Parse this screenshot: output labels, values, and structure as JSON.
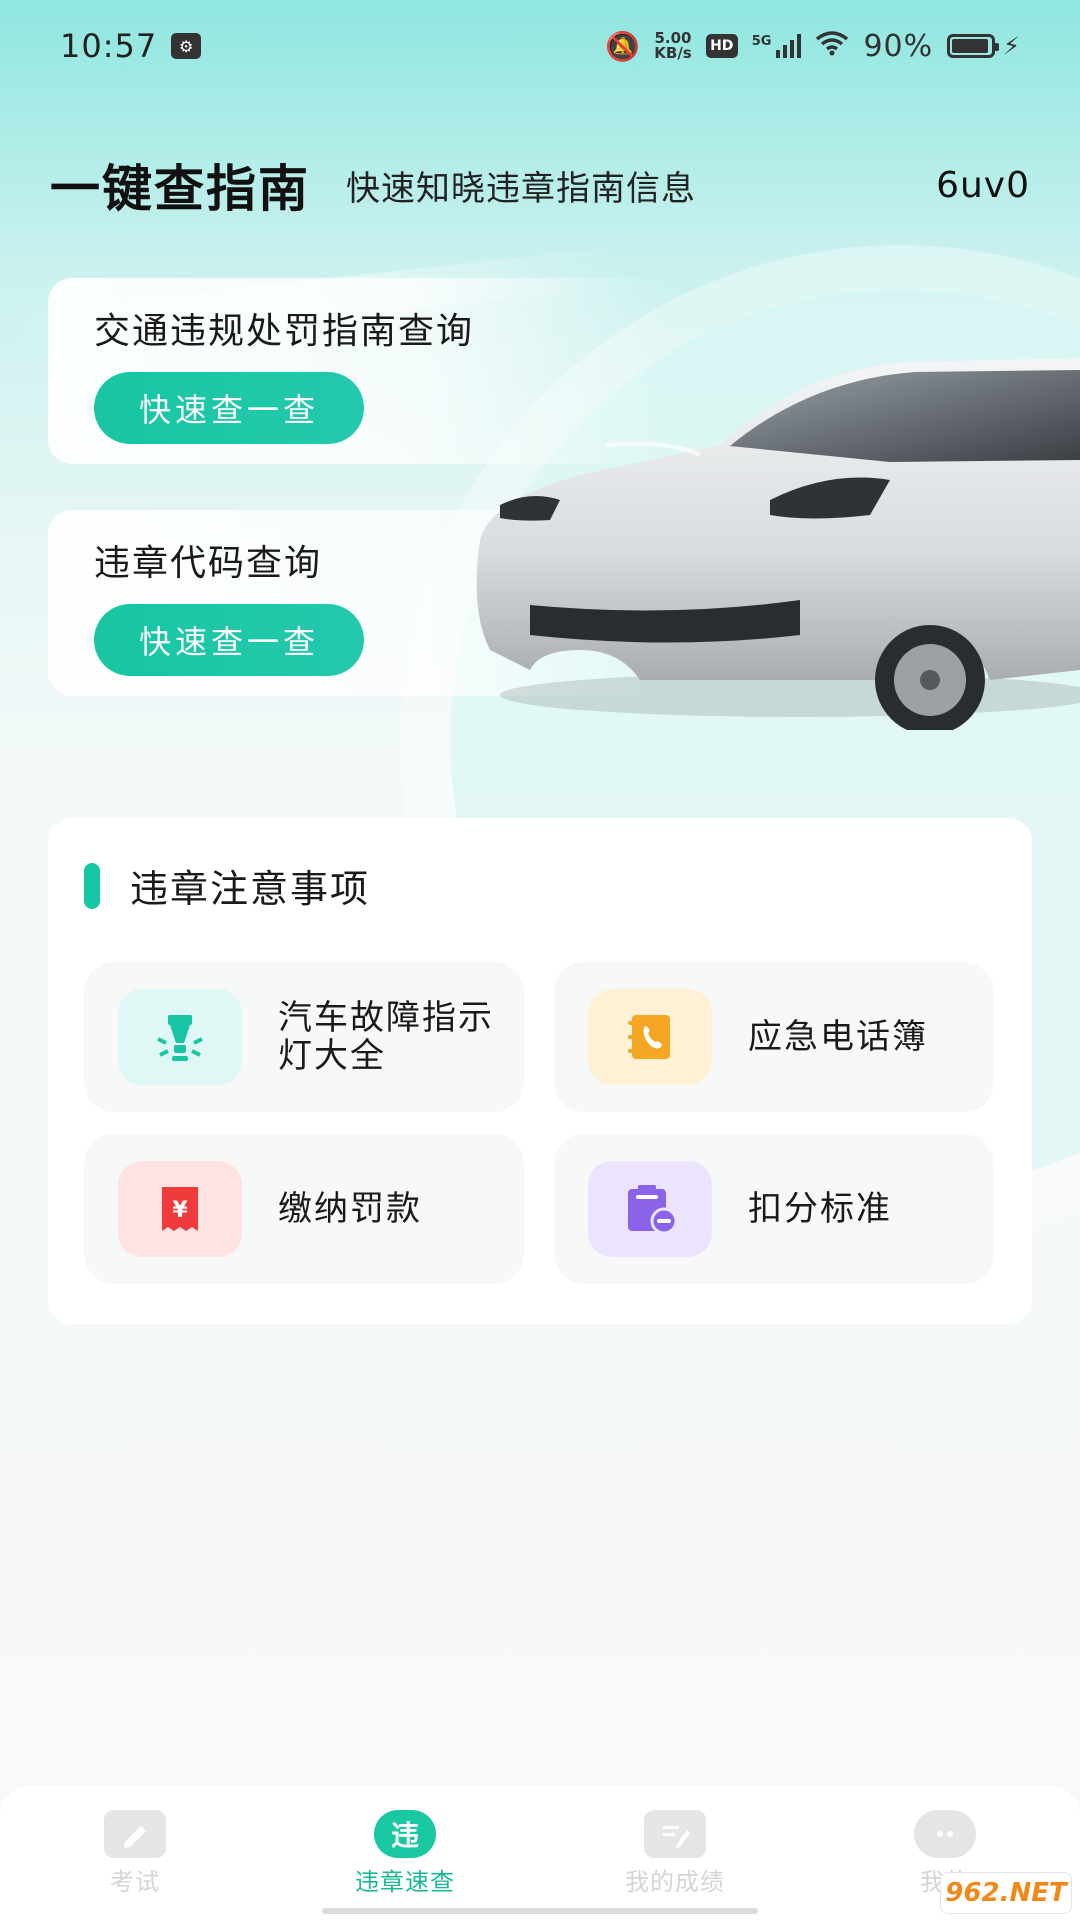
{
  "status_bar": {
    "time": "10:57",
    "net_speed_value": "5.00",
    "net_speed_unit": "KB/s",
    "hd": "HD",
    "network": "5G",
    "battery": "90%"
  },
  "header": {
    "title": "一键查指南",
    "subtitle": "快速知晓违章指南信息",
    "code": "6uv0"
  },
  "query_cards": [
    {
      "title": "交通违规处罚指南查询",
      "button": "快速查一查"
    },
    {
      "title": "违章代码查询",
      "button": "快速查一查"
    }
  ],
  "notes": {
    "title": "违章注意事项",
    "items": [
      {
        "label": "汽车故障指示灯大全",
        "icon": "warning-light-icon",
        "bg": "#dff8f6",
        "color": "#18c4a3"
      },
      {
        "label": "应急电话簿",
        "icon": "phonebook-icon",
        "bg": "#fff1d6",
        "color": "#f5a623"
      },
      {
        "label": "缴纳罚款",
        "icon": "fine-receipt-icon",
        "bg": "#ffe3e3",
        "color": "#ef3b3b"
      },
      {
        "label": "扣分标准",
        "icon": "deduction-calendar-icon",
        "bg": "#ece4ff",
        "color": "#8a63e8"
      }
    ]
  },
  "bottom_nav": [
    {
      "label": "考试",
      "icon": "pencil-icon",
      "active": false
    },
    {
      "label": "违章速查",
      "icon": "violation-search-icon",
      "icon_text": "违",
      "active": true
    },
    {
      "label": "我的成绩",
      "icon": "score-icon",
      "active": false
    },
    {
      "label": "我的",
      "icon": "chat-icon",
      "active": false
    }
  ],
  "watermark": "962.NET",
  "colors": {
    "accent": "#17c6a1"
  }
}
